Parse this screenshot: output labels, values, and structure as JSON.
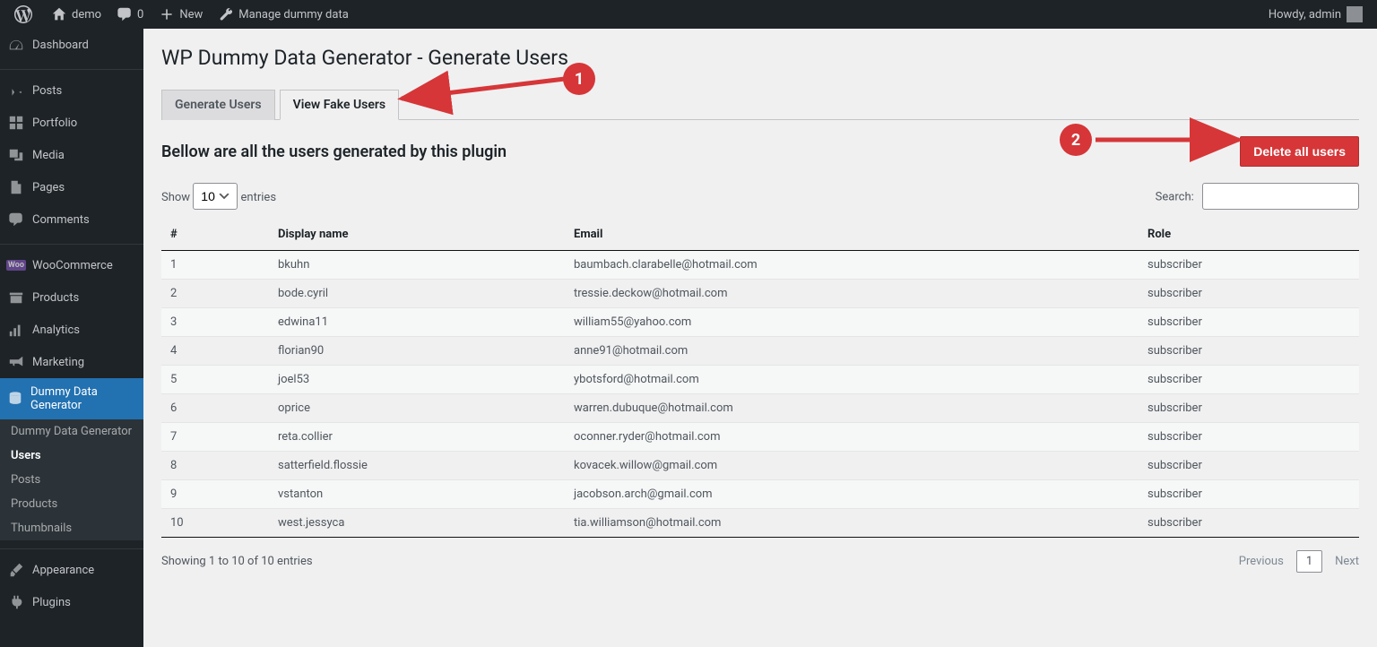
{
  "adminbar": {
    "site_name": "demo",
    "comments_count": "0",
    "new_label": "New",
    "manage_dummy_label": "Manage dummy data",
    "howdy": "Howdy, admin"
  },
  "sidebar": {
    "items": [
      {
        "label": "Dashboard",
        "icon": "dashboard"
      },
      {
        "label": "Posts",
        "icon": "pin"
      },
      {
        "label": "Portfolio",
        "icon": "grid"
      },
      {
        "label": "Media",
        "icon": "media"
      },
      {
        "label": "Pages",
        "icon": "page"
      },
      {
        "label": "Comments",
        "icon": "comment"
      },
      {
        "label": "WooCommerce",
        "icon": "woo"
      },
      {
        "label": "Products",
        "icon": "archive"
      },
      {
        "label": "Analytics",
        "icon": "chart"
      },
      {
        "label": "Marketing",
        "icon": "megaphone"
      },
      {
        "label": "Dummy Data Generator",
        "icon": "database",
        "current": true
      }
    ],
    "submenu": [
      {
        "label": "Dummy Data Generator"
      },
      {
        "label": "Users",
        "current": true
      },
      {
        "label": "Posts"
      },
      {
        "label": "Products"
      },
      {
        "label": "Thumbnails"
      }
    ],
    "bottom": [
      {
        "label": "Appearance",
        "icon": "brush"
      },
      {
        "label": "Plugins",
        "icon": "plug"
      }
    ]
  },
  "page": {
    "title": "WP Dummy Data Generator - Generate Users",
    "tabs": [
      {
        "label": "Generate Users",
        "active": false
      },
      {
        "label": "View Fake Users",
        "active": true
      }
    ],
    "subhead": "Bellow are all the users generated by this plugin",
    "delete_button": "Delete all users",
    "length_prefix": "Show",
    "length_value": "10",
    "length_suffix": "entries",
    "search_label": "Search:",
    "columns": [
      "#",
      "Display name",
      "Email",
      "Role"
    ],
    "rows": [
      {
        "n": "1",
        "name": "bkuhn",
        "email": "baumbach.clarabelle@hotmail.com",
        "role": "subscriber"
      },
      {
        "n": "2",
        "name": "bode.cyril",
        "email": "tressie.deckow@hotmail.com",
        "role": "subscriber"
      },
      {
        "n": "3",
        "name": "edwina11",
        "email": "william55@yahoo.com",
        "role": "subscriber"
      },
      {
        "n": "4",
        "name": "florian90",
        "email": "anne91@hotmail.com",
        "role": "subscriber"
      },
      {
        "n": "5",
        "name": "joel53",
        "email": "ybotsford@hotmail.com",
        "role": "subscriber"
      },
      {
        "n": "6",
        "name": "oprice",
        "email": "warren.dubuque@hotmail.com",
        "role": "subscriber"
      },
      {
        "n": "7",
        "name": "reta.collier",
        "email": "oconner.ryder@hotmail.com",
        "role": "subscriber"
      },
      {
        "n": "8",
        "name": "satterfield.flossie",
        "email": "kovacek.willow@gmail.com",
        "role": "subscriber"
      },
      {
        "n": "9",
        "name": "vstanton",
        "email": "jacobson.arch@gmail.com",
        "role": "subscriber"
      },
      {
        "n": "10",
        "name": "west.jessyca",
        "email": "tia.williamson@hotmail.com",
        "role": "subscriber"
      }
    ],
    "info": "Showing 1 to 10 of 10 entries",
    "prev": "Previous",
    "page_current": "1",
    "next": "Next"
  },
  "annotations": {
    "badge1": "1",
    "badge2": "2"
  }
}
